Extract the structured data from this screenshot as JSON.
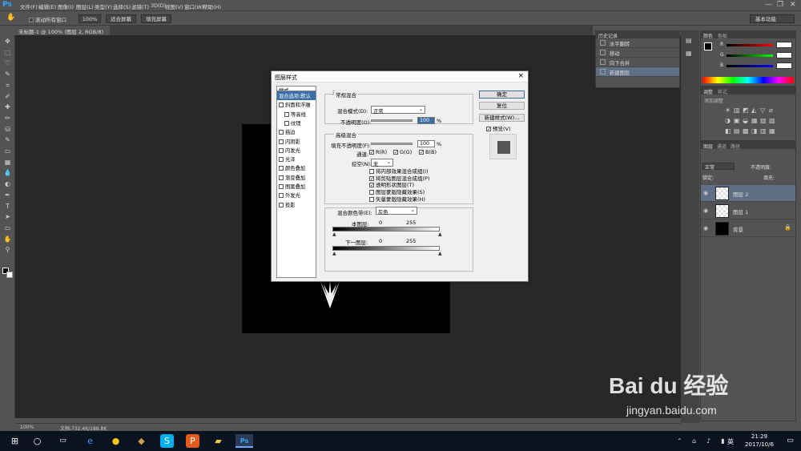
{
  "menubar": {
    "logo": "Ps",
    "items": [
      "文件(F)",
      "编辑(E)",
      "图像(I)",
      "图层(L)",
      "类型(Y)",
      "选择(S)",
      "滤镜(T)",
      "3D(D)",
      "视图(V)",
      "窗口(W)",
      "帮助(H)"
    ],
    "window_controls": [
      "—",
      "❐",
      "✕"
    ]
  },
  "options": {
    "scroll_all": "滚动所有窗口",
    "zoom": "100%",
    "fit_screen": "适合屏幕",
    "fill_screen": "填充屏幕",
    "workspace": "基本功能"
  },
  "doc_tab": {
    "title": "未标题-1 @ 100% (图层 2, RGB/8) *",
    "close": "×"
  },
  "status": {
    "zoom": "100%",
    "doc": "文档:732.4K/188.8K"
  },
  "history": {
    "title": "历史记录",
    "items": [
      "水平翻转",
      "移动",
      "向下合并",
      "新建图层"
    ],
    "selected_index": 3
  },
  "color_panel": {
    "tabs": [
      "颜色",
      "色板"
    ],
    "channels": [
      "R",
      "G",
      "B"
    ]
  },
  "adjust_panel": {
    "tabs": [
      "调整",
      "样式"
    ],
    "subtitle": "添加调整"
  },
  "layers_panel": {
    "tabs": [
      "图层",
      "通道",
      "路径"
    ],
    "kind": "正常",
    "opacity_label": "不透明度:",
    "lock_label": "锁定:",
    "fill_label": "填充:",
    "layers": [
      {
        "name": "图层 2",
        "selected": true,
        "thumb": "checker"
      },
      {
        "name": "图层 1",
        "selected": false,
        "thumb": "checker"
      },
      {
        "name": "背景",
        "selected": false,
        "thumb": "black"
      }
    ]
  },
  "dialog": {
    "title": "图层样式",
    "close": "×",
    "styles_header": "样式",
    "styles": [
      "混合选项:默认",
      "斜面和浮雕",
      "等高线",
      "纹理",
      "描边",
      "内阴影",
      "内发光",
      "光泽",
      "颜色叠加",
      "渐变叠加",
      "图案叠加",
      "外发光",
      "投影"
    ],
    "blend_options": "混合选项",
    "general": {
      "title": "常规混合",
      "mode_label": "混合模式(D):",
      "mode": "正常",
      "opacity_label": "不透明度(O):",
      "opacity": "100",
      "pct": "%"
    },
    "advanced": {
      "title": "高级混合",
      "fill_label": "填充不透明度(F):",
      "fill": "100",
      "pct": "%",
      "channels_label": "通道:",
      "channels": [
        "R(R)",
        "G(G)",
        "B(B)"
      ],
      "knockout_label": "挖空(N):",
      "knockout": "无",
      "options": [
        {
          "label": "将内部效果混合成组(I)",
          "checked": false
        },
        {
          "label": "将剪贴图层混合成组(P)",
          "checked": true
        },
        {
          "label": "透明形状图层(T)",
          "checked": true
        },
        {
          "label": "图层蒙版隐藏效果(S)",
          "checked": false
        },
        {
          "label": "矢量蒙版隐藏效果(H)",
          "checked": false
        }
      ]
    },
    "blend_if": {
      "label": "混合颜色带(E):",
      "value": "灰色",
      "this_layer": "本图层:",
      "under_layer": "下一图层:",
      "min": "0",
      "max": "255"
    },
    "buttons": {
      "ok": "确定",
      "reset": "复位",
      "new_style": "新建样式(W)...",
      "preview": "预览(V)"
    }
  },
  "taskbar": {
    "time": "21:29",
    "date": "2017/10/6",
    "ime": "英"
  },
  "watermark": {
    "brand": "Bai du 经验",
    "url": "jingyan.baidu.com"
  }
}
